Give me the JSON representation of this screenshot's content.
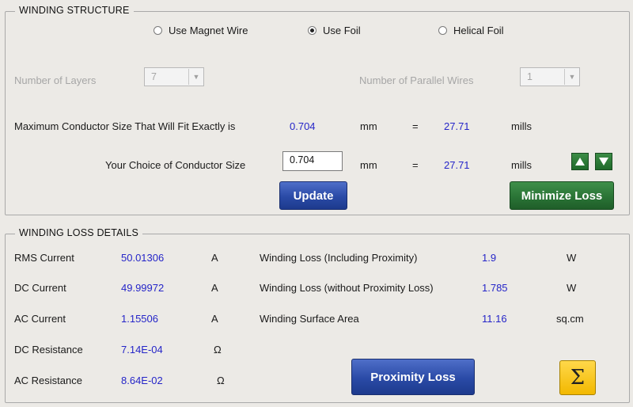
{
  "winding_structure": {
    "title": "WINDING STRUCTURE",
    "radios": [
      {
        "label": "Use Magnet Wire",
        "selected": false
      },
      {
        "label": "Use Foil",
        "selected": true
      },
      {
        "label": "Helical Foil",
        "selected": false
      }
    ],
    "layers_label": "Number of Layers",
    "layers_value": "7",
    "parallel_label": "Number of Parallel Wires",
    "parallel_value": "1",
    "max_size_label": "Maximum Conductor Size That Will Fit Exactly is",
    "max_size_mm": "0.704",
    "max_size_mills": "27.71",
    "choice_label": "Your Choice of Conductor Size",
    "choice_value": "0.704",
    "choice_mills": "27.71",
    "unit_mm": "mm",
    "equals": "=",
    "unit_mills": "mills",
    "update_label": "Update",
    "minimize_label": "Minimize Loss"
  },
  "winding_loss": {
    "title": "WINDING LOSS DETAILS",
    "left_rows": [
      {
        "label": "RMS Current",
        "value": "50.01306",
        "unit": "A"
      },
      {
        "label": "DC Current",
        "value": "49.99972",
        "unit": "A"
      },
      {
        "label": "AC  Current",
        "value": "1.15506",
        "unit": "A"
      },
      {
        "label": "DC Resistance",
        "value": "7.14E-04",
        "unit": "Ω"
      },
      {
        "label": "AC Resistance",
        "value": "8.64E-02",
        "unit": "Ω"
      }
    ],
    "right_rows": [
      {
        "label": "Winding Loss (Including Proximity)",
        "value": "1.9",
        "unit": "W"
      },
      {
        "label": "Winding Loss (without Proximity Loss)",
        "value": "1.785",
        "unit": "W"
      },
      {
        "label": "Winding Surface Area",
        "value": "11.16",
        "unit": "sq.cm"
      }
    ],
    "proximity_label": "Proximity Loss",
    "sigma_symbol": "Σ"
  },
  "icons": {
    "up": "up-arrow-icon",
    "down": "down-arrow-icon",
    "sigma": "sigma-icon"
  },
  "colors": {
    "value_blue": "#2525c8",
    "button_blue": "#2a4aa6",
    "button_green": "#2a7436",
    "sigma_yellow": "#f2b800"
  }
}
